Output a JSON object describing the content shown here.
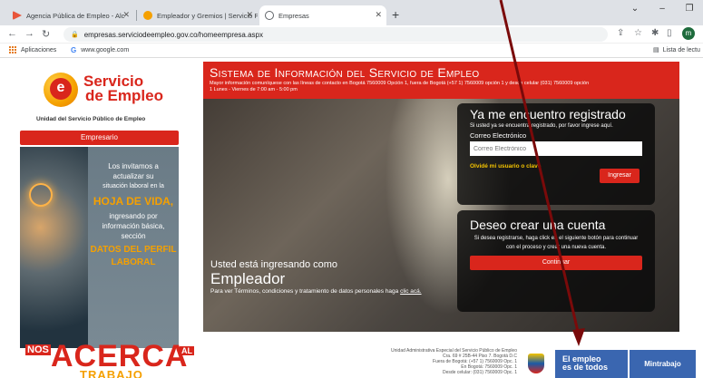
{
  "browser": {
    "tabs": [
      {
        "title": "Agencia Pública de Empleo - Alc",
        "favicon_color": "#e8553a"
      },
      {
        "title": "Empleador y Gremios | Servicio P",
        "favicon_color": "#f5a000"
      },
      {
        "title": "Empresas",
        "favicon_color": "#5f6368"
      }
    ],
    "new_tab": "+",
    "url": "empresas.serviciodeempleo.gov.co/homeempresa.aspx",
    "profile_initial": "m",
    "bookmarks": [
      "Aplicaciones",
      "www.google.com"
    ],
    "reading_list": "Lista de lectu",
    "window_controls": [
      "⌄",
      "–",
      "❐",
      "✕"
    ]
  },
  "logo": {
    "line1": "Servicio",
    "line2": "de Empleo",
    "subtitle": "Unidad del Servicio Público de Empleo"
  },
  "sidebar": {
    "empresario_label": "Empresario",
    "promo_lines": [
      "Los invitamos a",
      "actualizar su",
      "situación laboral en la"
    ],
    "promo_bold1": "HOJA DE VIDA,",
    "promo_lines2": [
      "ingresando por",
      "información básica,",
      "sección"
    ],
    "promo_bold2": [
      "DATOS DEL PERFIL",
      "LABORAL"
    ]
  },
  "hero": {
    "title": "Sistema de Información del Servicio de Empleo",
    "info": "Mayor información comuníquese con las líneas de contacto en Bogotá 7560009 Opción 1, fuera de Bogotá (+57 1) 7560009 opción 1 y desde celular (031) 7560009 opción 1 Lunes - Viernes de 7:00 am - 5:00 pm",
    "login": {
      "title": "Ya me encuentro registrado",
      "subtitle": "Si usted ya se encuentra registrado, por favor ingrese aquí.",
      "email_label": "Correo Electrónico",
      "email_placeholder": "Correo Electrónico",
      "forgot": "Olvidé mi usuario o clave",
      "submit": "Ingresar"
    },
    "create": {
      "title": "Deseo crear una cuenta",
      "description": "Si desea registrarse, haga click en el siguiente botón para continuar con el proceso y crear una nueva cuenta.",
      "button": "Continuar"
    },
    "user_type": {
      "line1": "Usted está ingresando como",
      "line2": "Empleador",
      "terms": "Para ver Términos, condiciones y tratamiento de datos personales haga ",
      "terms_link": "clic acá."
    }
  },
  "footer": {
    "nos_left": "NOS",
    "nos_main": "ACERCA",
    "nos_al": "AL",
    "nos_sub": "TRABAJO",
    "address_lines": [
      "Unidad Administrativa Especial del Servicio Público de Empleo",
      "Cra. 69 # 25B-44 Piso 7. Bogotá D.C",
      "Fuera de Bogotá: (+57 1) 7560009 Opc. 1",
      "En Bogotá: 7560009 Opc. 1",
      "Desde celular: (031) 7560009 Opc. 1"
    ],
    "empleo_line1": "El empleo",
    "empleo_line2": "es de todos",
    "mintrabajo": "Mintrabajo"
  }
}
